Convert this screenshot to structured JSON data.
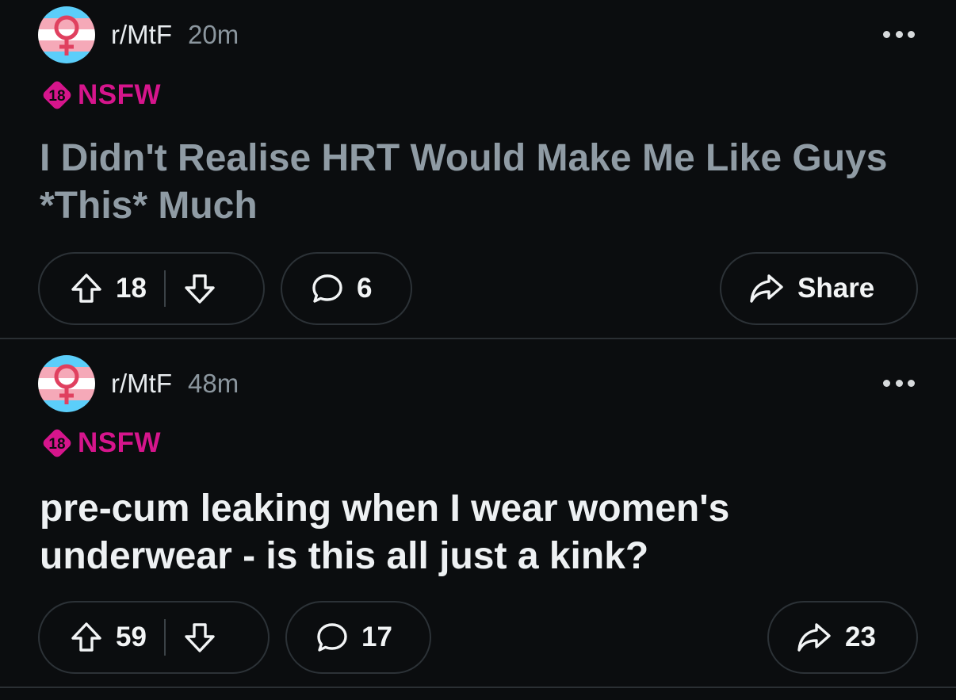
{
  "colors": {
    "background": "#0b0d0f",
    "nsfw": "#d6158c",
    "visited_title": "#8f9ba4",
    "title": "#eef1f3",
    "muted": "#8b969e",
    "trans_blue": "#5bcefa",
    "trans_pink": "#f5a9b8"
  },
  "posts": [
    {
      "subreddit": "r/MtF",
      "time": "20m",
      "nsfw_badge": "18",
      "nsfw_label": "NSFW",
      "title": "I Didn't Realise HRT Would Make Me Like Guys *This* Much",
      "upvotes": "18",
      "comments": "6",
      "share": "Share",
      "icons": {
        "more": "more-options-icon",
        "up": "upvote-arrow-icon",
        "down": "downvote-arrow-icon",
        "comment": "comment-bubble-icon",
        "share": "share-arrow-icon"
      }
    },
    {
      "subreddit": "r/MtF",
      "time": "48m",
      "nsfw_badge": "18",
      "nsfw_label": "NSFW",
      "title": "pre-cum leaking when I wear women's underwear - is this all just a kink?",
      "upvotes": "59",
      "comments": "17",
      "share": "23",
      "icons": {
        "more": "more-options-icon",
        "up": "upvote-arrow-icon",
        "down": "downvote-arrow-icon",
        "comment": "comment-bubble-icon",
        "share": "share-arrow-icon"
      }
    }
  ]
}
